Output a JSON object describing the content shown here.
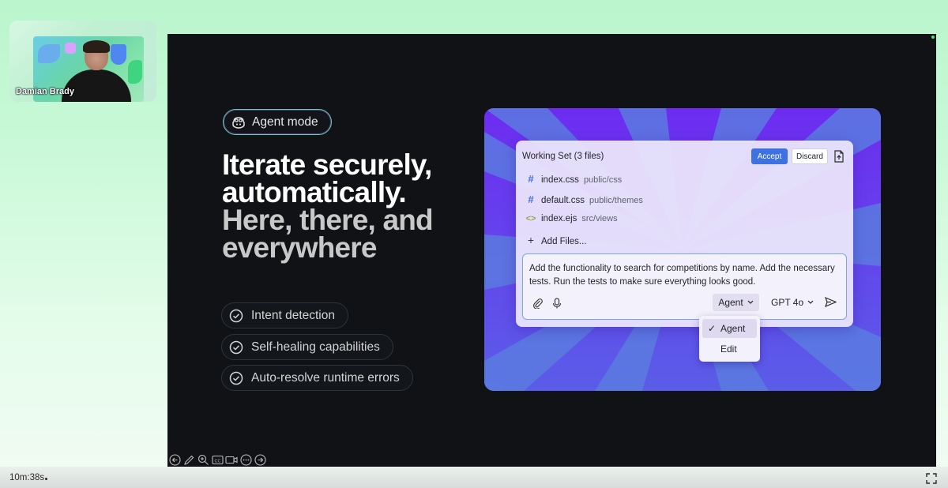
{
  "webcam": {
    "name": "Damian Brady"
  },
  "slide": {
    "badge": "Agent mode",
    "headline": {
      "line1": "Iterate securely,",
      "line2": "automatically.",
      "line3": "Here, there, and",
      "line4": "everywhere"
    },
    "features": [
      "Intent detection",
      "Self-healing capabilities",
      "Auto-resolve runtime errors"
    ],
    "mock": {
      "title": "Working Set (3 files)",
      "accept_label": "Accept",
      "discard_label": "Discard",
      "files": [
        {
          "name": "index.css",
          "path": "public/css",
          "icon": "hash-icon"
        },
        {
          "name": "default.css",
          "path": "public/themes",
          "icon": "hash-icon"
        },
        {
          "name": "index.ejs",
          "path": "src/views",
          "icon": "code-icon"
        }
      ],
      "add_files_label": "Add Files...",
      "prompt_text": "Add the functionality to search for competitions by name. Add the necessary tests. Run the tests to make sure everything looks good.",
      "mode_selected": "Agent",
      "model_selected": "GPT 4o",
      "mode_options": [
        "Agent",
        "Edit"
      ]
    }
  },
  "bottom": {
    "timer": "10m:38s"
  },
  "colors": {
    "accent_blue": "#3d72e0",
    "slide_bg": "#101215",
    "mock_purple": "#6a3cf0"
  }
}
